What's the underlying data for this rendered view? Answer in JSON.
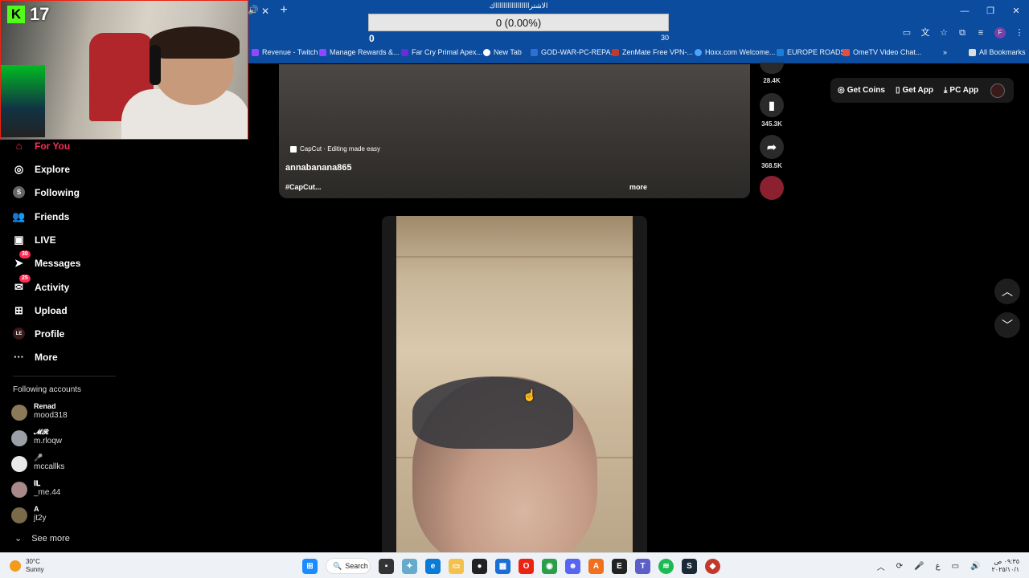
{
  "browser": {
    "bookmarks": [
      {
        "label": "Revenue - Twitch",
        "color": "#9146ff"
      },
      {
        "label": "Manage Rewards &...",
        "color": "#9146ff"
      },
      {
        "label": "Far Cry Primal Apex...",
        "color": "#6a2bd8"
      },
      {
        "label": "New Tab",
        "color": "#ffffff"
      },
      {
        "label": "GOD-WAR-PC-REPA...",
        "color": "#2f6fd6"
      },
      {
        "label": "ZenMate Free VPN-...",
        "color": "#c0392b"
      },
      {
        "label": "Hoxx.com Welcome...",
        "color": "#4aa3ff"
      },
      {
        "label": "EUROPE ROADS",
        "color": "#1c7ed6"
      },
      {
        "label": "OmeTV Video Chat...",
        "color": "#e74c3c"
      }
    ],
    "all_bookmarks": "All Bookmarks",
    "overflow": "»",
    "profile_initial": "F"
  },
  "progress": {
    "title": "الاشتراااااااااااااااااك",
    "display": "0 (0.00%)",
    "min": "0",
    "max": "30",
    "fraction": 0.0
  },
  "kick": {
    "logo": "K",
    "count": "17"
  },
  "sidebar": {
    "nav": [
      {
        "label": "For You",
        "icon": "home-icon"
      },
      {
        "label": "Explore",
        "icon": "compass-icon"
      },
      {
        "label": "Following",
        "icon": "following-icon"
      },
      {
        "label": "Friends",
        "icon": "friends-icon"
      },
      {
        "label": "LIVE",
        "icon": "live-icon"
      },
      {
        "label": "Messages",
        "icon": "messages-icon",
        "badge": "30"
      },
      {
        "label": "Activity",
        "icon": "activity-icon",
        "badge": "25"
      },
      {
        "label": "Upload",
        "icon": "upload-icon"
      },
      {
        "label": "Profile",
        "icon": "profile-icon"
      },
      {
        "label": "More",
        "icon": "more-icon"
      }
    ],
    "following_title": "Following accounts",
    "accounts": [
      {
        "name": "Renad",
        "handle": "mood318",
        "color": "#8a7a5a"
      },
      {
        "name": "𝓜𝓡",
        "handle": "m.rloqw",
        "color": "#9aa0a6"
      },
      {
        "name": "🎤",
        "handle": "mccallks",
        "color": "#e8e8e8"
      },
      {
        "name": "𝐈𝐋",
        "handle": "_me.44",
        "color": "#a88888"
      },
      {
        "name": "A",
        "handle": "jt2y",
        "color": "#7a6a4a"
      }
    ],
    "see_more": "See more"
  },
  "video1": {
    "caption": "CapCut · Editing made easy",
    "username": "annabanana865",
    "tags": "#CapCut...",
    "more": "more",
    "actions": [
      {
        "count": "28.4K",
        "icon": "comment-icon"
      },
      {
        "count": "345.3K",
        "icon": "bookmark-icon"
      },
      {
        "count": "368.5K",
        "icon": "share-icon"
      }
    ]
  },
  "topbar": {
    "get_coins": "Get Coins",
    "get_app": "Get App",
    "pc_app": "PC App"
  },
  "taskbar": {
    "temp": "30°C",
    "weather": "Sunny",
    "search": "Search",
    "lang": "ع",
    "time": "٠٩:٣٥ ص",
    "date": "٢٠٢٥/١٠/١"
  }
}
